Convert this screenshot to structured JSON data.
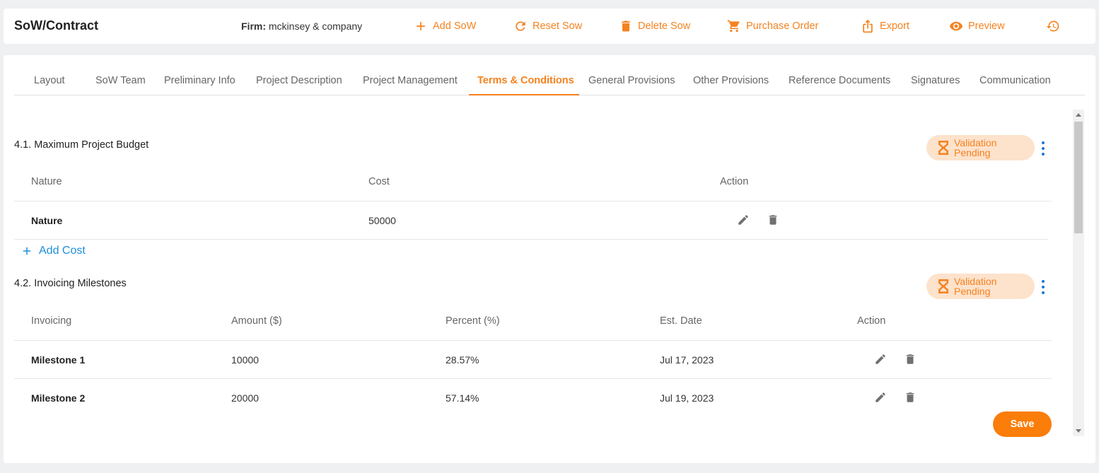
{
  "header": {
    "title": "SoW/Contract",
    "firm_label": "Firm:",
    "firm_value": "mckinsey & company",
    "actions": {
      "add_sow": "Add SoW",
      "reset_sow": "Reset Sow",
      "delete_sow": "Delete Sow",
      "purchase_order": "Purchase Order",
      "export": "Export",
      "preview": "Preview"
    }
  },
  "tabs": [
    "Layout",
    "SoW Team",
    "Preliminary Info",
    "Project Description",
    "Project Management",
    "Terms & Conditions",
    "General Provisions",
    "Other Provisions",
    "Reference Documents",
    "Signatures",
    "Communication"
  ],
  "active_tab": "Terms & Conditions",
  "budget": {
    "title": "4.1. Maximum Project Budget",
    "status": "Validation Pending",
    "columns": [
      "Nature",
      "Cost",
      "Action"
    ],
    "rows": [
      {
        "nature": "Nature",
        "cost": "50000"
      }
    ],
    "add_label": "Add Cost"
  },
  "milestones": {
    "title": "4.2. Invoicing Milestones",
    "status": "Validation Pending",
    "columns": [
      "Invoicing",
      "Amount ($)",
      "Percent (%)",
      "Est. Date",
      "Action"
    ],
    "rows": [
      {
        "name": "Milestone 1",
        "amount": "10000",
        "percent": "28.57%",
        "date": "Jul 17, 2023"
      },
      {
        "name": "Milestone 2",
        "amount": "20000",
        "percent": "57.14%",
        "date": "Jul 19, 2023"
      }
    ]
  },
  "save_label": "Save",
  "colors": {
    "accent": "#f5821f",
    "link": "#1e8fd8",
    "badge_bg": "#fde2cc",
    "kebab": "#1a78d2"
  }
}
